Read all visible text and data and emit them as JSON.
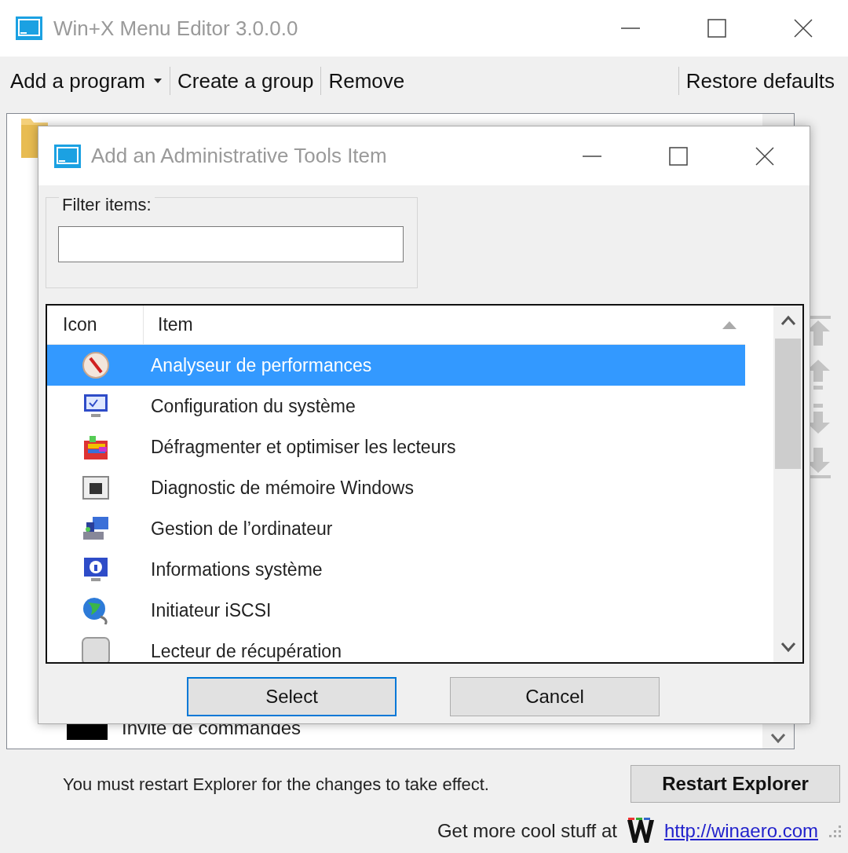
{
  "window": {
    "title": "Win+X Menu Editor 3.0.0.0"
  },
  "toolbar": [
    {
      "label": "Add a program",
      "kind": "dropdown"
    },
    {
      "label": "Create a group",
      "kind": "button"
    },
    {
      "label": "Remove",
      "kind": "button"
    },
    {
      "label": "Restore defaults",
      "kind": "button"
    }
  ],
  "tree": {
    "items": [
      {
        "kind": "group"
      },
      {
        "kind": "program",
        "label": "Invite de commandes"
      }
    ]
  },
  "dialog": {
    "title": "Add an Administrative Tools Item",
    "filter_label": "Filter items:",
    "list": {
      "columns": [
        "Icon",
        "Item"
      ],
      "rows": [
        {
          "kind": "gauge",
          "label": "Analyseur de performances",
          "selected": true
        },
        {
          "kind": "monitor-check",
          "label": "Configuration du système",
          "selected": false
        },
        {
          "kind": "defrag",
          "label": "Défragmenter et optimiser les lecteurs",
          "selected": false
        },
        {
          "kind": "memory",
          "label": "Diagnostic de mémoire Windows",
          "selected": false
        },
        {
          "kind": "management",
          "label": "Gestion de l’ordinateur",
          "selected": false
        },
        {
          "kind": "monitor-info",
          "label": "Informations système",
          "selected": false
        },
        {
          "kind": "globe",
          "label": "Initiateur iSCSI",
          "selected": false
        },
        {
          "kind": "drive",
          "label": "Lecteur de récupération",
          "selected": false
        }
      ]
    },
    "buttons": [
      {
        "label": "Select",
        "default": true
      },
      {
        "label": "Cancel",
        "default": false
      }
    ]
  },
  "status": {
    "message": "You must restart Explorer for the changes to take effect.",
    "button": "Restart Explorer"
  },
  "footer": {
    "text": "Get more cool stuff at",
    "link": "http://winaero.com"
  }
}
